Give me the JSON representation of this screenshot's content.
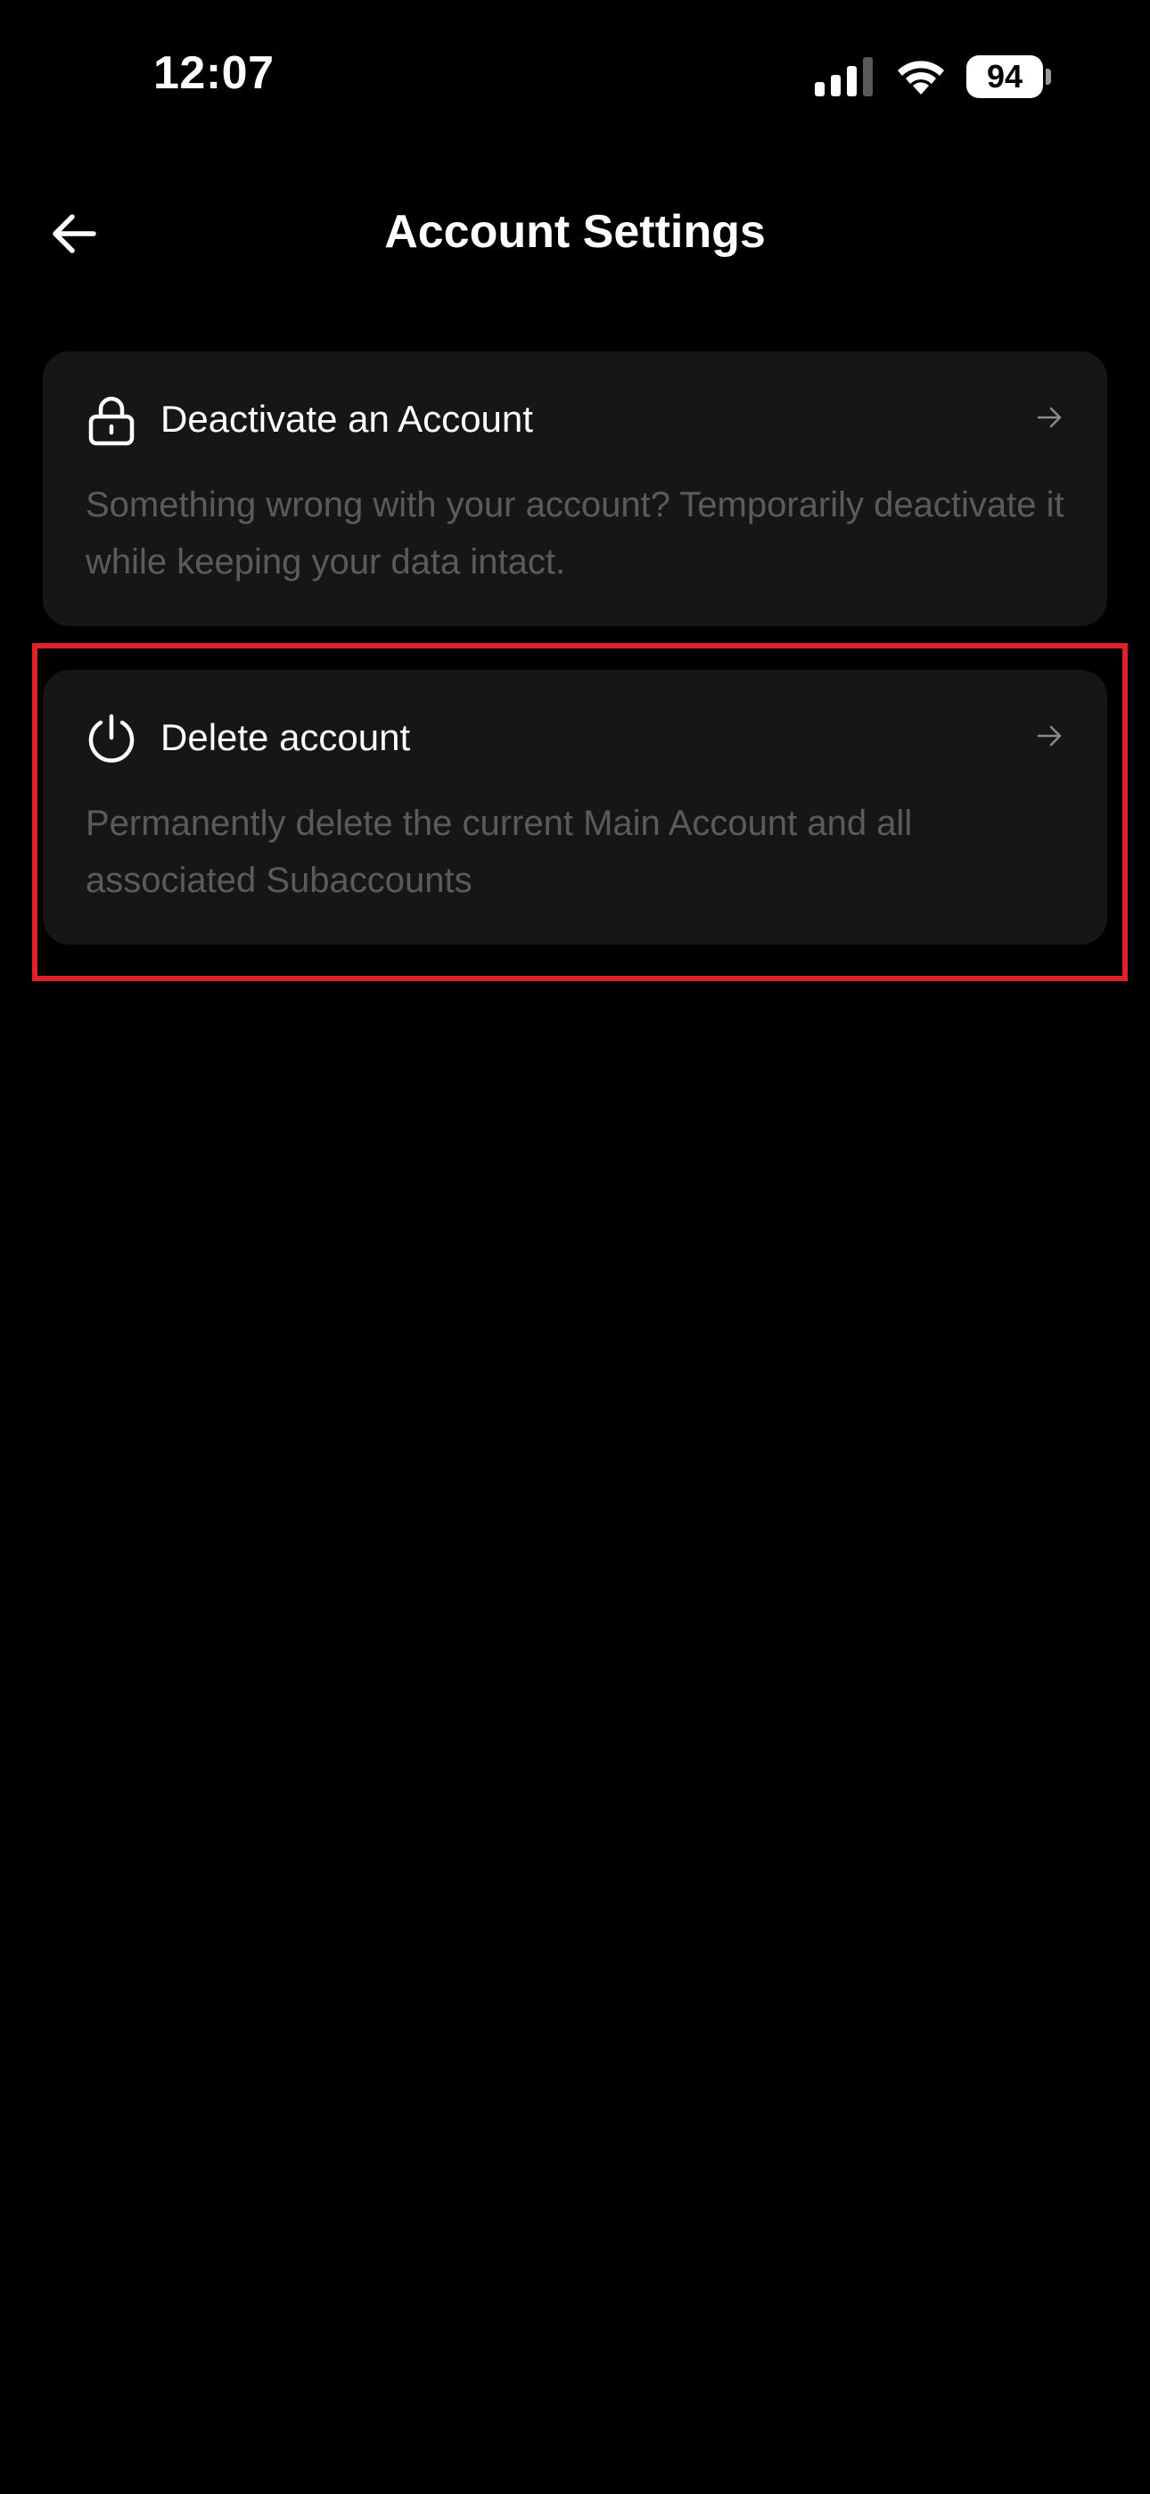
{
  "status_bar": {
    "time": "12:07",
    "battery_level": "94",
    "signal_icon": "cellular-signal-icon",
    "wifi_icon": "wifi-icon"
  },
  "header": {
    "title": "Account Settings",
    "back_icon": "arrow-left-icon"
  },
  "cards": [
    {
      "icon": "lock-icon",
      "title": "Deactivate an Account",
      "description": "Something wrong with your account? Temporarily deactivate it while keeping your data intact.",
      "chevron_icon": "arrow-right-icon"
    },
    {
      "icon": "power-icon",
      "title": "Delete account",
      "description": "Permanently delete the current Main Account and all associated Subaccounts",
      "chevron_icon": "arrow-right-icon"
    }
  ],
  "colors": {
    "background": "#000000",
    "card_background": "#161616",
    "title_text": "#ffffff",
    "description_text": "#5b5b5b",
    "highlight": "#e0202a"
  }
}
